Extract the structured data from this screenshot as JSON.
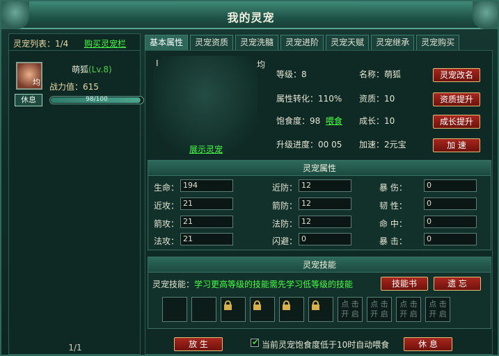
{
  "window": {
    "title": "我的灵宠"
  },
  "left": {
    "list_label": "灵宠列表：1/4",
    "buy_slot": "购买灵宠栏",
    "pet": {
      "name": "萌狐",
      "level": "(Lv.8)",
      "power": "战力值：615",
      "avatar_badge": "均",
      "hp_text": "98/100",
      "hp_fraction": 0.98
    },
    "rest_button": "休息",
    "page": "1/1"
  },
  "tabs": [
    "基本属性",
    "灵宠资质",
    "灵宠洗髓",
    "灵宠进阶",
    "灵宠天赋",
    "灵宠继承",
    "灵宠购买"
  ],
  "info": {
    "portrait_i": "I",
    "portrait_jun": "均",
    "show_pet": "展示灵宠",
    "level": "等级：8",
    "name": "名称：萌狐",
    "conversion": "属性转化：110%",
    "aptitude": "资质：10",
    "satiety": "饱食度：98",
    "feed": "喂食",
    "growth": "成长：10",
    "upgrade": "升级进度：00 05",
    "speedup": "加速：2元宝",
    "buttons": {
      "rename": "灵宠改名",
      "aptitude_up": "资质提升",
      "growth_up": "成长提升",
      "speed": "加  速"
    }
  },
  "attributes": {
    "title": "灵宠属性",
    "rows": [
      {
        "l1": "生命：",
        "v1": "194",
        "l2": "近防：",
        "v2": "12",
        "l3": "暴    伤：",
        "v3": "0"
      },
      {
        "l1": "近攻：",
        "v1": "21",
        "l2": "箭防：",
        "v2": "12",
        "l3": "韧    性：",
        "v3": "0"
      },
      {
        "l1": "箭攻：",
        "v1": "21",
        "l2": "法防：",
        "v2": "12",
        "l3": "命    中：",
        "v3": "0"
      },
      {
        "l1": "法攻：",
        "v1": "21",
        "l2": "闪避：",
        "v2": "0",
        "l3": "暴    击：",
        "v3": "0"
      }
    ]
  },
  "skills": {
    "title": "灵宠技能",
    "label": "灵宠技能：",
    "hint": "学习更高等级的技能需先学习低等级的技能",
    "book_button": "技能书",
    "forget_button": "遗 忘",
    "slot_open_line1": "点 击",
    "slot_open_line2": "开 启"
  },
  "footer": {
    "release_button": "放  生",
    "rest_button": "休  息",
    "auto_feed": "当前灵宠饱食度低于10时自动喂食"
  }
}
